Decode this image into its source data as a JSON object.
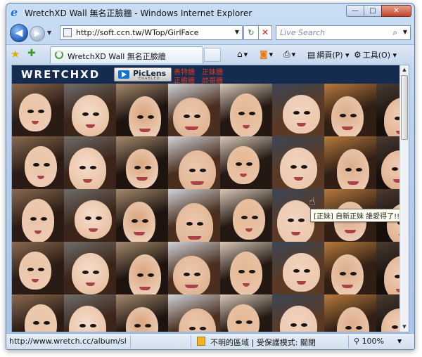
{
  "window": {
    "title": "WretchXD Wall 無名正臉牆 - Windows Internet Explorer",
    "buttons": {
      "minimize": "—",
      "maximize": "□",
      "close": "✕"
    }
  },
  "navigation": {
    "back_glyph": "◀",
    "forward_glyph": "▶",
    "address": "http://soft.ccn.tw/WTop/GirlFace",
    "refresh_glyph": "↻",
    "stop_glyph": "✕",
    "search_placeholder": "Live Search"
  },
  "tab": {
    "label": "WretchXD Wall 無名正臉牆"
  },
  "command_bar": {
    "page_label": "網頁(P)",
    "tools_label": "工具(O)"
  },
  "site": {
    "brand": "WRETCHXD",
    "piclens_label": "PicLens",
    "piclens_sub": "ENABLED",
    "links": [
      "表特牆",
      "正妹牆",
      "正臉牆",
      "帥哥牆"
    ]
  },
  "tooltip": "[正妹] 自新正妹 誰愛得了!!!",
  "status_bar": {
    "url": "http://www.wretch.cc/album/show",
    "zone": "不明的區域 | 受保護模式: 關閉",
    "zoom": "100%"
  },
  "colors": {
    "header_bg": "#152b4f",
    "link_red": "#e03a1f"
  },
  "icons": [
    "ie-icon",
    "favorites-star-icon",
    "add-favorites-icon",
    "home-icon",
    "rss-icon",
    "print-icon",
    "page-icon",
    "tools-gear-icon",
    "search-icon",
    "security-zone-icon",
    "zoom-icon"
  ]
}
